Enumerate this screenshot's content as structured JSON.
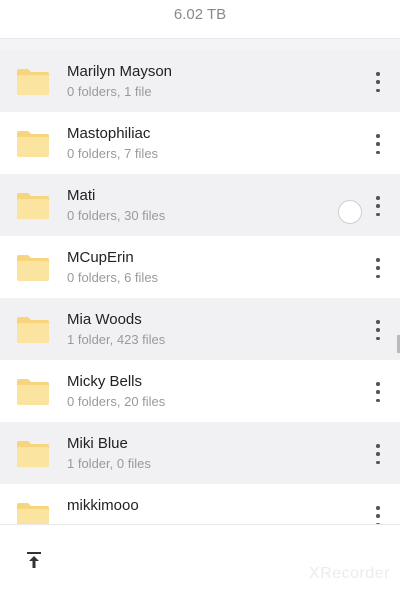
{
  "header": {
    "storage_total": "6.02 TB"
  },
  "folders": [
    {
      "name": "Marilyn Mayson",
      "meta": "0 folders, 1 file"
    },
    {
      "name": "Mastophiliac",
      "meta": "0 folders, 7 files"
    },
    {
      "name": "Mati",
      "meta": "0 folders, 30 files"
    },
    {
      "name": "MCupErin",
      "meta": "0 folders, 6 files"
    },
    {
      "name": "Mia Woods",
      "meta": "1 folder, 423 files"
    },
    {
      "name": "Micky Bells",
      "meta": "0 folders, 20 files"
    },
    {
      "name": "Miki Blue",
      "meta": "1 folder, 0 files"
    },
    {
      "name": "mikkimooo",
      "meta": ""
    }
  ],
  "colors": {
    "folder_fill": "#fbe3a0",
    "folder_tab": "#f6d57c",
    "accent_text": "#222222"
  },
  "icons": {
    "folder": "folder-icon",
    "more": "more-vertical-icon",
    "select": "select-circle-icon",
    "scroll_top": "scroll-to-top-icon"
  },
  "watermark": "XRecorder"
}
